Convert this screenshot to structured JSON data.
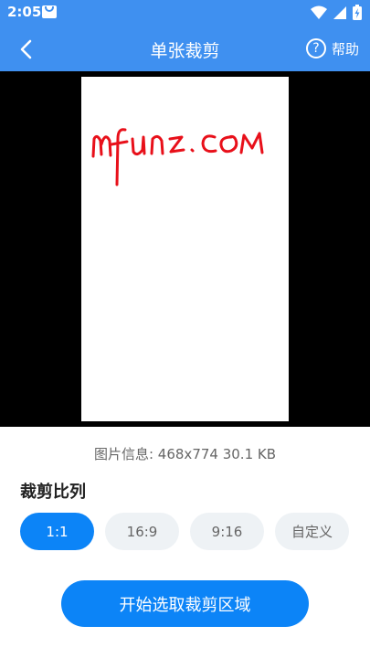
{
  "status_bar": {
    "time": "2:05"
  },
  "nav": {
    "title": "单张裁剪",
    "help_label": "帮助",
    "help_glyph": "?"
  },
  "preview": {
    "handwriting_text": "mfunz.COM"
  },
  "info": {
    "text": "图片信息: 468x774 30.1 KB"
  },
  "crop_ratio": {
    "title": "裁剪比列",
    "options": [
      {
        "label": "1:1",
        "selected": true
      },
      {
        "label": "16:9",
        "selected": false
      },
      {
        "label": "9:16",
        "selected": false
      },
      {
        "label": "自定义",
        "selected": false
      }
    ]
  },
  "actions": {
    "start_label": "开始选取裁剪区域"
  },
  "colors": {
    "header_blue": "#3f90f0",
    "accent_blue": "#0c84f7",
    "chip_gray": "#eef2f5",
    "handwriting_red": "#e8101a"
  }
}
